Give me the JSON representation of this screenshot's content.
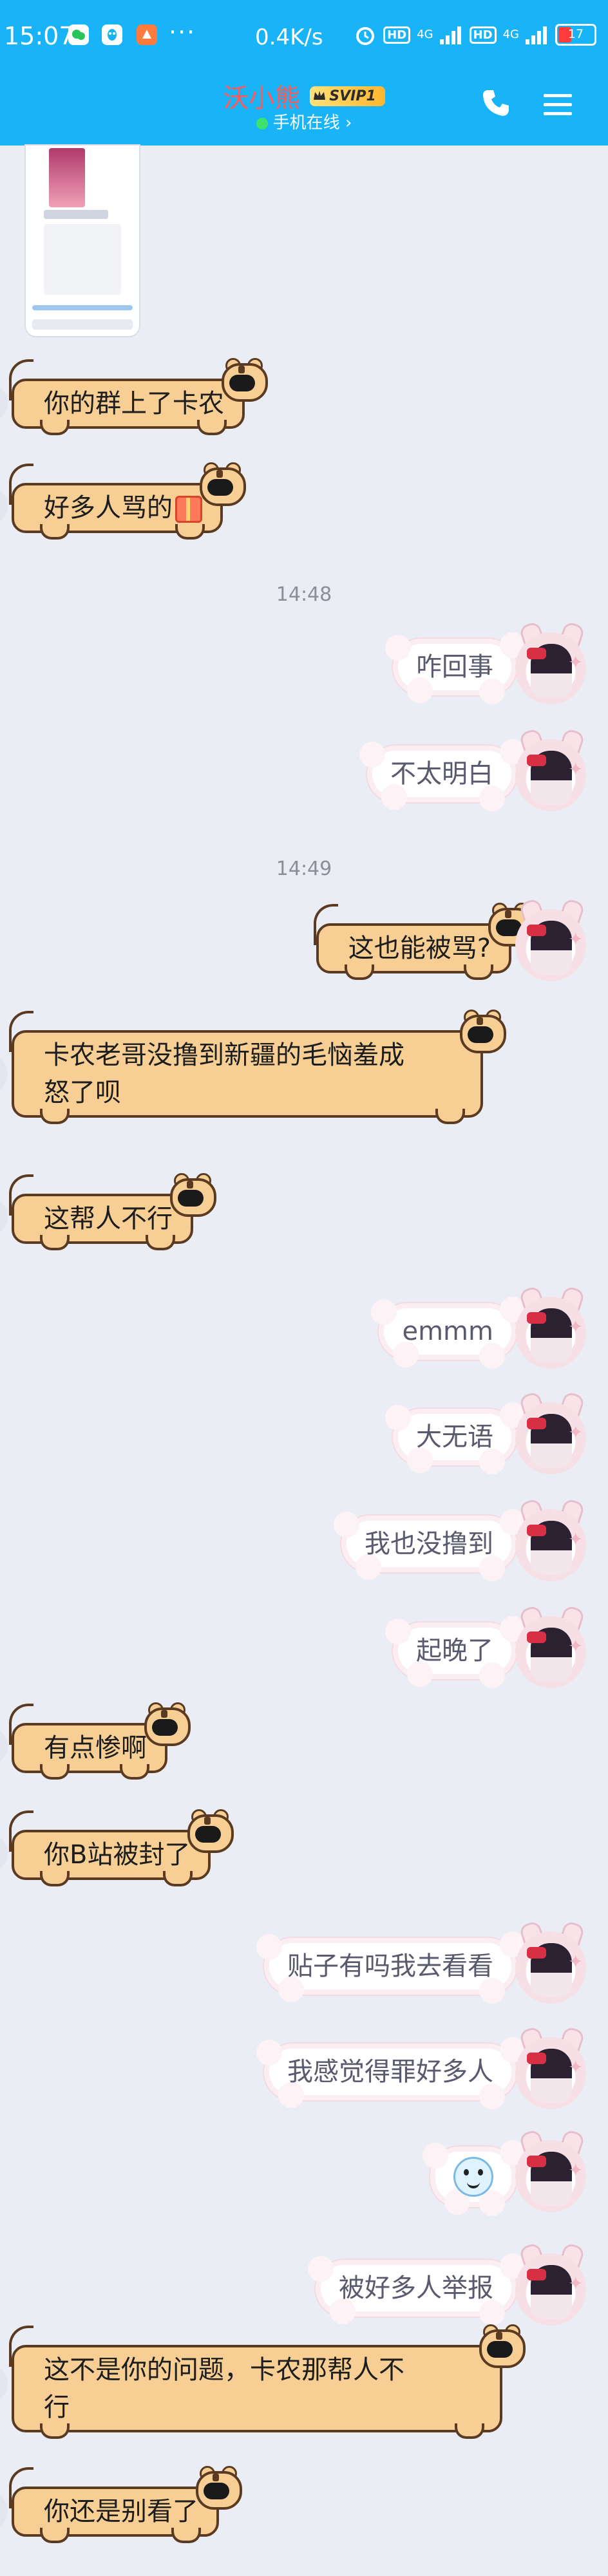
{
  "status_bar": {
    "time": "15:07",
    "dots": "···",
    "net_speed": "0.4K/s",
    "hd1": "HD",
    "net1": "4G",
    "hd2": "HD",
    "net2": "4G",
    "battery": "17",
    "icons": [
      "wechat-icon",
      "qq-icon",
      "app-icon",
      "alarm-icon",
      "signal-icon",
      "battery-icon"
    ]
  },
  "header": {
    "contact_name": "沃小熊",
    "vip_badge": "SVIP1",
    "online_status": "手机在线",
    "online_chevron": "›",
    "icons": [
      "phone-icon",
      "menu-icon"
    ],
    "accent": "#19b4f7",
    "name_color": "#ff5a5a"
  },
  "messages": [
    {
      "type": "image",
      "from": "left"
    },
    {
      "type": "text",
      "from": "left",
      "text": "你的群上了卡农"
    },
    {
      "type": "text",
      "from": "left",
      "text": "好多人骂的",
      "emoji": "gift-icon"
    },
    {
      "type": "time",
      "text": "14:48"
    },
    {
      "type": "text",
      "from": "right",
      "text": "咋回事"
    },
    {
      "type": "text",
      "from": "right",
      "text": "不太明白"
    },
    {
      "type": "time",
      "text": "14:49"
    },
    {
      "type": "text",
      "from": "right",
      "text": "这也能被骂?"
    },
    {
      "type": "text",
      "from": "left",
      "text": "卡农老哥没撸到新疆的毛恼羞成",
      "text2": "怒了呗"
    },
    {
      "type": "text",
      "from": "left",
      "text": "这帮人不行"
    },
    {
      "type": "text",
      "from": "right",
      "text": "emmm"
    },
    {
      "type": "text",
      "from": "right",
      "text": "大无语"
    },
    {
      "type": "text",
      "from": "right",
      "text": "我也没撸到"
    },
    {
      "type": "text",
      "from": "right",
      "text": "起晚了"
    },
    {
      "type": "text",
      "from": "left",
      "text": "有点惨啊"
    },
    {
      "type": "text",
      "from": "left",
      "text": "你B站被封了"
    },
    {
      "type": "text",
      "from": "right",
      "text": "贴子有吗我去看看"
    },
    {
      "type": "text",
      "from": "right",
      "text": "我感觉得罪好多人"
    },
    {
      "type": "sticker",
      "from": "right",
      "emoji": "smile-face-icon"
    },
    {
      "type": "text",
      "from": "right",
      "text": "被好多人举报"
    },
    {
      "type": "text",
      "from": "left",
      "text": "这不是你的问题，卡农那帮人不",
      "text2": "行"
    },
    {
      "type": "text",
      "from": "left",
      "text": "你还是别看了"
    }
  ],
  "colors": {
    "left_bubble": "#f7cf94",
    "left_border": "#5a3b22",
    "right_bubble": "#ffffff",
    "background": "#ebedf4"
  }
}
